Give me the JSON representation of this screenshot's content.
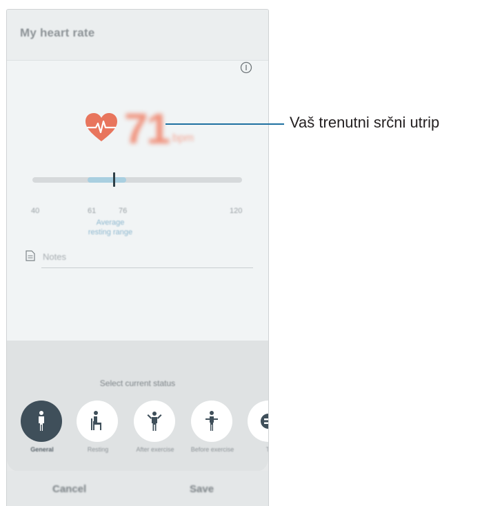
{
  "app": {
    "title": "My heart rate"
  },
  "heart_rate": {
    "value": "71",
    "unit": "bpm"
  },
  "range": {
    "ticks": [
      "40",
      "61",
      "76",
      "120"
    ],
    "avg_label_line1": "Average",
    "avg_label_line2": "resting range",
    "current": 71,
    "min": 40,
    "max": 120,
    "avg_low": 61,
    "avg_high": 76
  },
  "notes": {
    "placeholder": "Notes"
  },
  "status": {
    "title": "Select current status",
    "items": [
      {
        "label": "General",
        "icon": "person-standing-icon",
        "active": true
      },
      {
        "label": "Resting",
        "icon": "person-sitting-icon",
        "active": false
      },
      {
        "label": "After exercise",
        "icon": "person-flexing-icon",
        "active": false
      },
      {
        "label": "Before exercise",
        "icon": "person-stretching-icon",
        "active": false
      },
      {
        "label": "Tr",
        "icon": "more-icon",
        "active": false
      }
    ]
  },
  "footer": {
    "cancel": "Cancel",
    "save": "Save"
  },
  "annotation": {
    "text": "Vaš trenutni srčni utrip"
  },
  "colors": {
    "accent_heart": "#e8755d",
    "range_avg": "#a9cfe0",
    "callout_line": "#1d6fa0",
    "active_status": "#3f4f5a"
  }
}
